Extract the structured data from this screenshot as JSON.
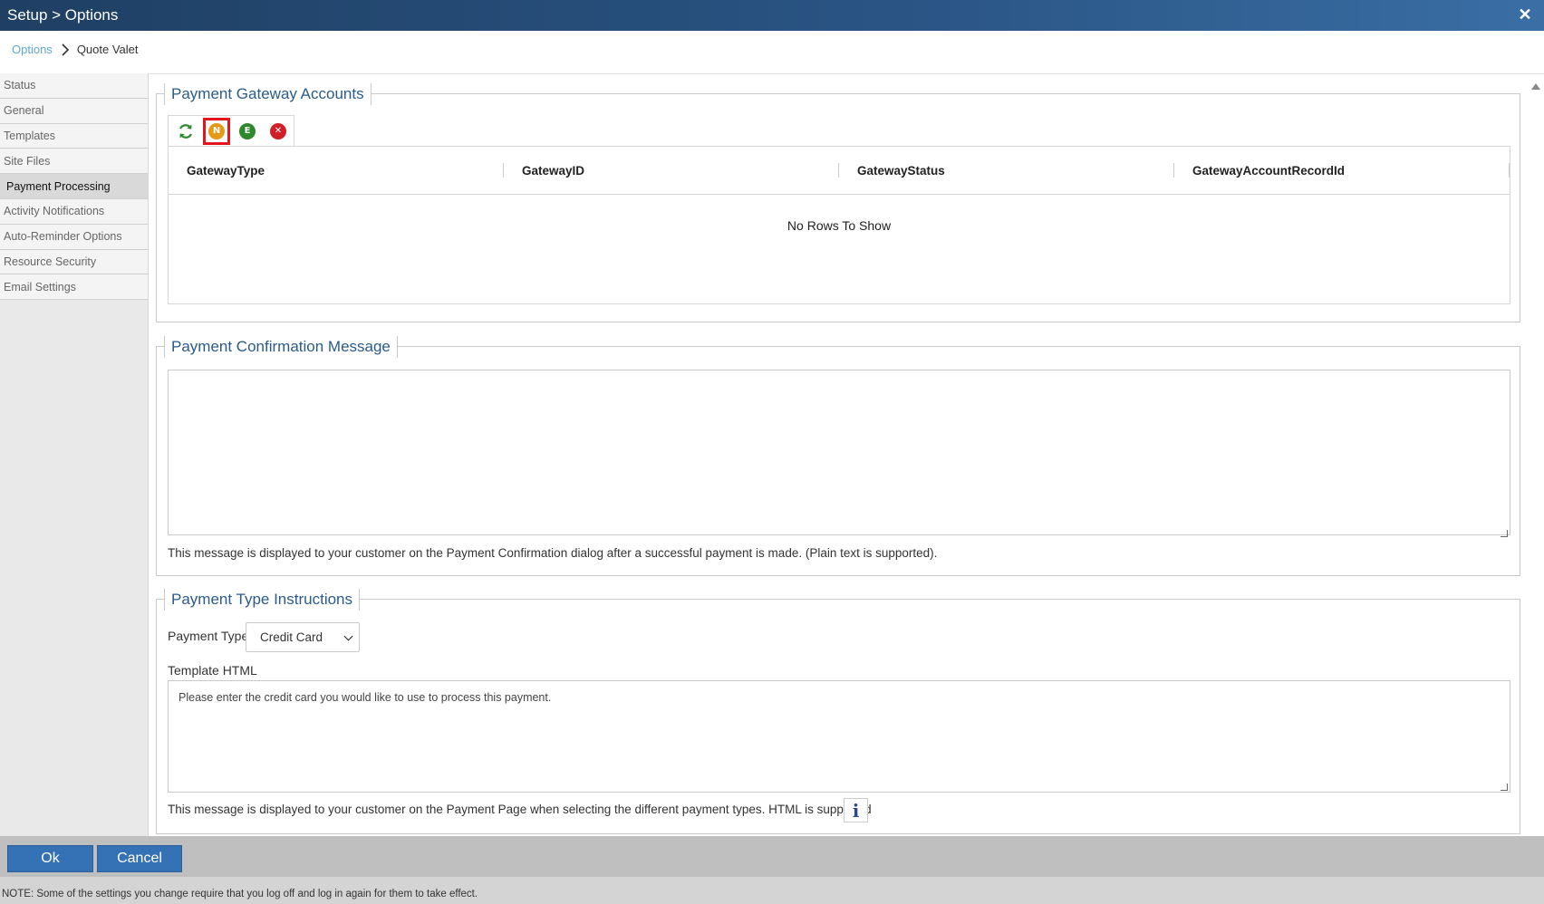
{
  "window": {
    "title": "Setup > Options",
    "close_glyph": "✕"
  },
  "breadcrumb": {
    "link": "Options",
    "current": "Quote Valet"
  },
  "sidebar": {
    "items": [
      {
        "label": "Status"
      },
      {
        "label": "General"
      },
      {
        "label": "Templates"
      },
      {
        "label": "Site Files"
      },
      {
        "label": "Payment Processing",
        "active": true
      },
      {
        "label": "Activity Notifications"
      },
      {
        "label": "Auto-Reminder Options"
      },
      {
        "label": "Resource Security"
      },
      {
        "label": "Email Settings"
      }
    ]
  },
  "gateway_panel": {
    "title": "Payment Gateway Accounts",
    "toolbar": [
      {
        "name": "refresh-icon",
        "glyph": "⟳"
      },
      {
        "name": "new-icon",
        "glyph": "N",
        "color": "#e59a17",
        "highlighted": true
      },
      {
        "name": "edit-icon",
        "glyph": "E",
        "color": "#2c8a2c"
      },
      {
        "name": "delete-icon",
        "glyph": "✕",
        "color": "#d01f26"
      }
    ],
    "columns": [
      "GatewayType",
      "GatewayID",
      "GatewayStatus",
      "GatewayAccountRecordId"
    ],
    "empty_text": "No Rows To Show"
  },
  "confirmation_panel": {
    "title": "Payment Confirmation Message",
    "value": "",
    "help": "This message is displayed to your customer on the Payment Confirmation dialog after a successful payment is made. (Plain text is supported)."
  },
  "instructions_panel": {
    "title": "Payment Type Instructions",
    "payment_type_label": "Payment Type",
    "payment_type_value": "Credit Card",
    "template_label": "Template HTML",
    "template_value": "Please enter the credit card you would like to use to process this payment.",
    "help": "This message is displayed to your customer on the Payment Page when selecting the different payment types. HTML is supported",
    "info_glyph": "i"
  },
  "footer": {
    "ok_label": "Ok",
    "cancel_label": "Cancel",
    "note": "NOTE: Some of the settings you change require that you log off and log in again for them to take effect."
  },
  "colors": {
    "title_bar": "#1f3f63",
    "accent": "#3571b5",
    "legend": "#2a5b8a",
    "highlight": "#e2161c"
  }
}
